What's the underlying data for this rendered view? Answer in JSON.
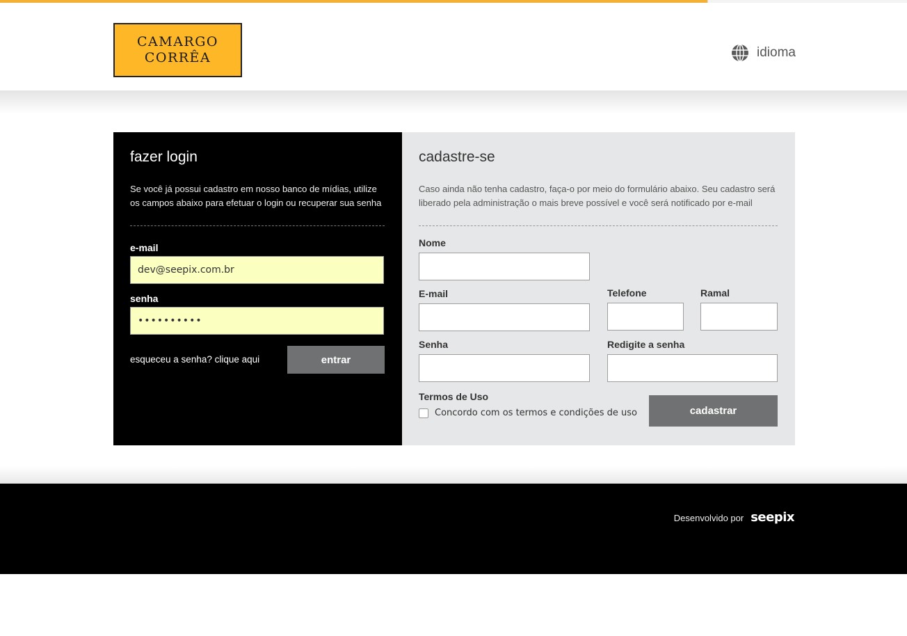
{
  "header": {
    "logo": {
      "line1": "CAMARGO",
      "line2": "CORRÊA",
      "color": "#fdb727"
    },
    "language": {
      "label": "idioma",
      "icon": "globe-icon"
    }
  },
  "login": {
    "title": "fazer login",
    "description": "Se você já possui cadastro em nosso banco de mídias, utilize os campos abaixo para efetuar o login ou recuperar sua senha",
    "email_label": "e-mail",
    "email_value": "dev@seepix.com.br",
    "password_label": "senha",
    "password_value": "••••••••••",
    "forgot_link": "esqueceu a senha? clique aqui",
    "submit_label": "entrar"
  },
  "register": {
    "title": "cadastre-se",
    "description": "Caso ainda não tenha cadastro, faça-o por meio do formulário abaixo. Seu cadastro será liberado pela administração o mais breve possível e você será notificado por e-mail",
    "name_label": "Nome",
    "email_label": "E-mail",
    "phone_label": "Telefone",
    "extension_label": "Ramal",
    "password_label": "Senha",
    "password_confirm_label": "Redigite a senha",
    "terms_label": "Termos de Uso",
    "terms_checkbox_label": "Concordo com os termos e condições de uso",
    "terms_checked": false,
    "submit_label": "cadastrar"
  },
  "footer": {
    "developed_by": "Desenvolvido por",
    "brand": "seepix"
  },
  "colors": {
    "accent_yellow": "#f2b134",
    "input_highlight": "#fbffbf",
    "button_gray": "#707172",
    "panel_gray": "#e6e7e8"
  }
}
